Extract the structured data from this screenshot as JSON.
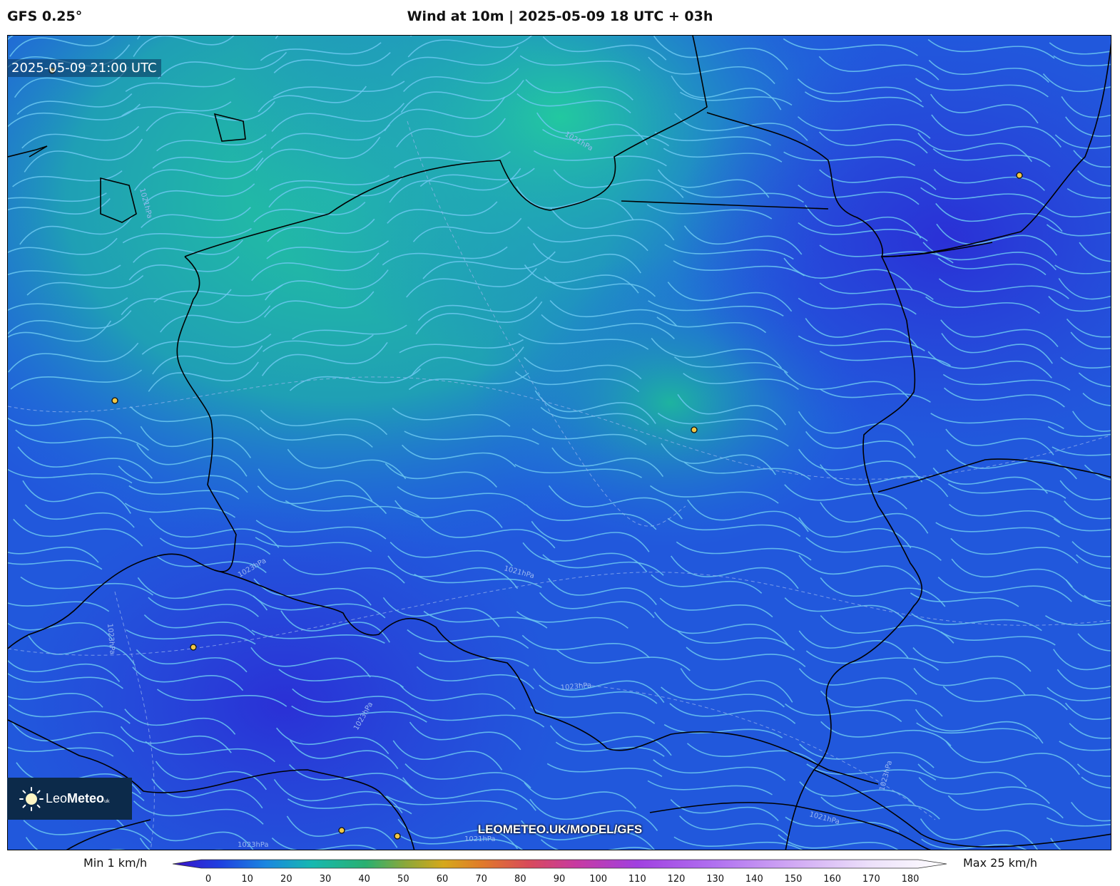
{
  "header": {
    "model": "GFS 0.25°",
    "title": "Wind at 10m | 2025-05-09 18 UTC + 03h"
  },
  "map": {
    "timestamp": "2025-05-09 21:00 UTC",
    "watermark": "LEOMETEO.UK/MODEL/GFS",
    "isobar_labels": [
      "1021hPa",
      "1021hPa",
      "1023hPa",
      "1023hPa",
      "1021hPa",
      "1023hPa",
      "1023hPa",
      "1023hPa",
      "1021hPa",
      "1023hPa",
      "1021hPa",
      "1021hPa"
    ],
    "colors": {
      "calm": "#2a3fd8",
      "moderate": "#1f6ee0",
      "strong": "#1fb39b",
      "streamline": "#6cc8f0",
      "border": "#000000",
      "city_marker": "#f2c744"
    }
  },
  "logo": {
    "name_light": "Leo",
    "name_bold": "Meteo",
    "suffix": "uk"
  },
  "colorbar": {
    "min_label": "Min 1 km/h",
    "max_label": "Max 25 km/h",
    "ticks": [
      "0",
      "10",
      "20",
      "30",
      "40",
      "50",
      "60",
      "70",
      "80",
      "90",
      "100",
      "110",
      "120",
      "130",
      "140",
      "150",
      "160",
      "170",
      "180"
    ]
  }
}
